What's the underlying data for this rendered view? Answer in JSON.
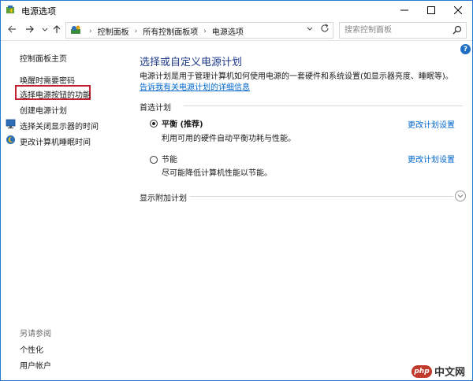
{
  "window": {
    "title": "电源选项"
  },
  "nav": {
    "breadcrumbs": [
      "控制面板",
      "所有控制面板项",
      "电源选项"
    ],
    "search_placeholder": "搜索控制面板"
  },
  "sidebar": {
    "home": "控制面板主页",
    "links": [
      "唤醒时需要密码",
      "选择电源按钮的功能",
      "创建电源计划",
      "选择关闭显示器的时间",
      "更改计算机睡眠时间"
    ],
    "highlighted_index": 1,
    "see_also_title": "另请参阅",
    "see_also": [
      "个性化",
      "用户帐户"
    ]
  },
  "main": {
    "title": "选择或自定义电源计划",
    "desc_text": "电源计划是用于管理计算机如何使用电源的一套硬件和系统设置(如显示器亮度、睡眠等)。",
    "desc_link": "告诉我有关电源计划的详细信息",
    "preferred_head": "首选计划",
    "plans": [
      {
        "name": "平衡 (推荐)",
        "desc": "利用可用的硬件自动平衡功耗与性能。",
        "change_link": "更改计划设置",
        "selected": true
      },
      {
        "name": "节能",
        "desc": "尽可能降低计算机性能以节能。",
        "change_link": "更改计划设置",
        "selected": false
      }
    ],
    "more_head": "显示附加计划"
  },
  "watermark": {
    "logo": "php",
    "text": "中文网"
  },
  "colors": {
    "accent_link": "#0066cc",
    "title_blue": "#1e3a8a",
    "highlight_red": "#c4202f",
    "window_border": "#2b78d0"
  }
}
